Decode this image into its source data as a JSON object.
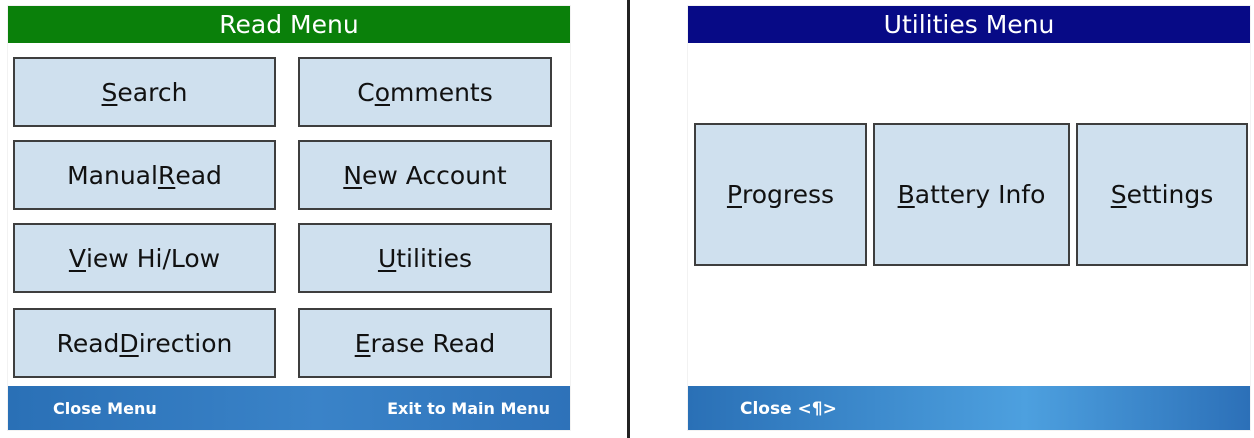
{
  "read_menu": {
    "title": "Read Menu",
    "buttons": [
      {
        "pre": "",
        "u": "S",
        "post": "earch"
      },
      {
        "pre": "C",
        "u": "o",
        "post": "mments"
      },
      {
        "pre": "Manual ",
        "u": "R",
        "post": "ead"
      },
      {
        "pre": "",
        "u": "N",
        "post": "ew Account"
      },
      {
        "pre": "",
        "u": "V",
        "post": "iew Hi/Low"
      },
      {
        "pre": "",
        "u": "U",
        "post": "tilities"
      },
      {
        "pre": "Read ",
        "u": "D",
        "post": "irection"
      },
      {
        "pre": "",
        "u": "E",
        "post": "rase Read"
      }
    ],
    "footer": {
      "left": "Close Menu",
      "right": "Exit to Main Menu"
    },
    "colors": {
      "title_bg": "#0a800a"
    }
  },
  "utilities_menu": {
    "title": "Utilities Menu",
    "buttons": [
      {
        "pre": "",
        "u": "P",
        "post": "rogress"
      },
      {
        "pre": "",
        "u": "B",
        "post": "attery Info"
      },
      {
        "pre": "",
        "u": "S",
        "post": "ettings"
      }
    ],
    "footer": {
      "left": "Close <¶>"
    },
    "colors": {
      "title_bg": "#070a86"
    }
  }
}
